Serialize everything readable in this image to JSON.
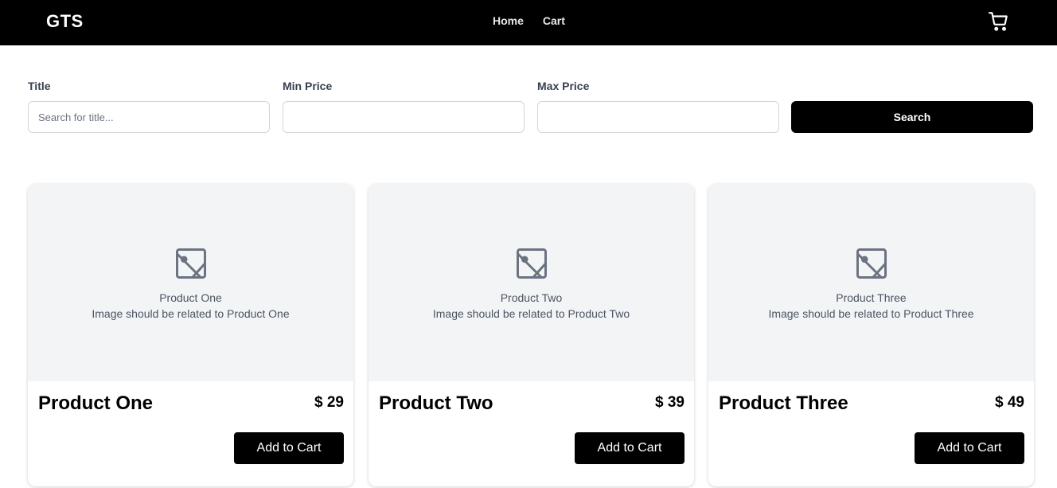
{
  "navbar": {
    "logo": "GTS",
    "links": [
      "Home",
      "Cart"
    ],
    "cart_icon": "shopping-cart-icon",
    "background": "#000000"
  },
  "filters": {
    "title_label": "Title",
    "title_placeholder": "Search for title...",
    "title_value": "",
    "min_price_label": "Min Price",
    "min_price_value": "",
    "max_price_label": "Max Price",
    "max_price_value": "",
    "search_label": "Search"
  },
  "products": [
    {
      "name": "Product One",
      "price": "$ 29",
      "image_title": "Product One",
      "image_note": "Image should be related to Product One",
      "button_label": "Add to Cart"
    },
    {
      "name": "Product Two",
      "price": "$ 39",
      "image_title": "Product Two",
      "image_note": "Image should be related to Product Two",
      "button_label": "Add to Cart"
    },
    {
      "name": "Product Three",
      "price": "$ 49",
      "image_title": "Product Three",
      "image_note": "Image should be related to Product Three",
      "button_label": "Add to Cart"
    }
  ],
  "colors": {
    "accent": "#000000",
    "placeholder_bg": "#f3f4f6",
    "placeholder_icon": "#6b7280"
  }
}
